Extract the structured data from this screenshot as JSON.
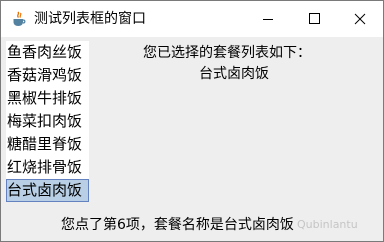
{
  "window": {
    "title": "测试列表框的窗口"
  },
  "list": {
    "items": [
      {
        "label": "鱼香肉丝饭"
      },
      {
        "label": "香菇滑鸡饭"
      },
      {
        "label": "黑椒牛排饭"
      },
      {
        "label": "梅菜扣肉饭"
      },
      {
        "label": "糖醋里脊饭"
      },
      {
        "label": "红烧排骨饭"
      },
      {
        "label": "台式卤肉饭"
      }
    ],
    "selected_index": 6
  },
  "panel": {
    "heading": "您已选择的套餐列表如下：",
    "selected_value": "台式卤肉饭"
  },
  "status": {
    "text": "您点了第6项，套餐名称是台式卤肉饭"
  },
  "watermark": {
    "text": "Qubinlantu"
  },
  "icons": {
    "app": "java-cup-icon",
    "minimize": "minimize-icon",
    "maximize": "maximize-icon",
    "close": "close-icon"
  },
  "colors": {
    "selection_bg": "#b8cfe5",
    "selection_border": "#6382bf",
    "content_bg": "#eeeeee"
  }
}
